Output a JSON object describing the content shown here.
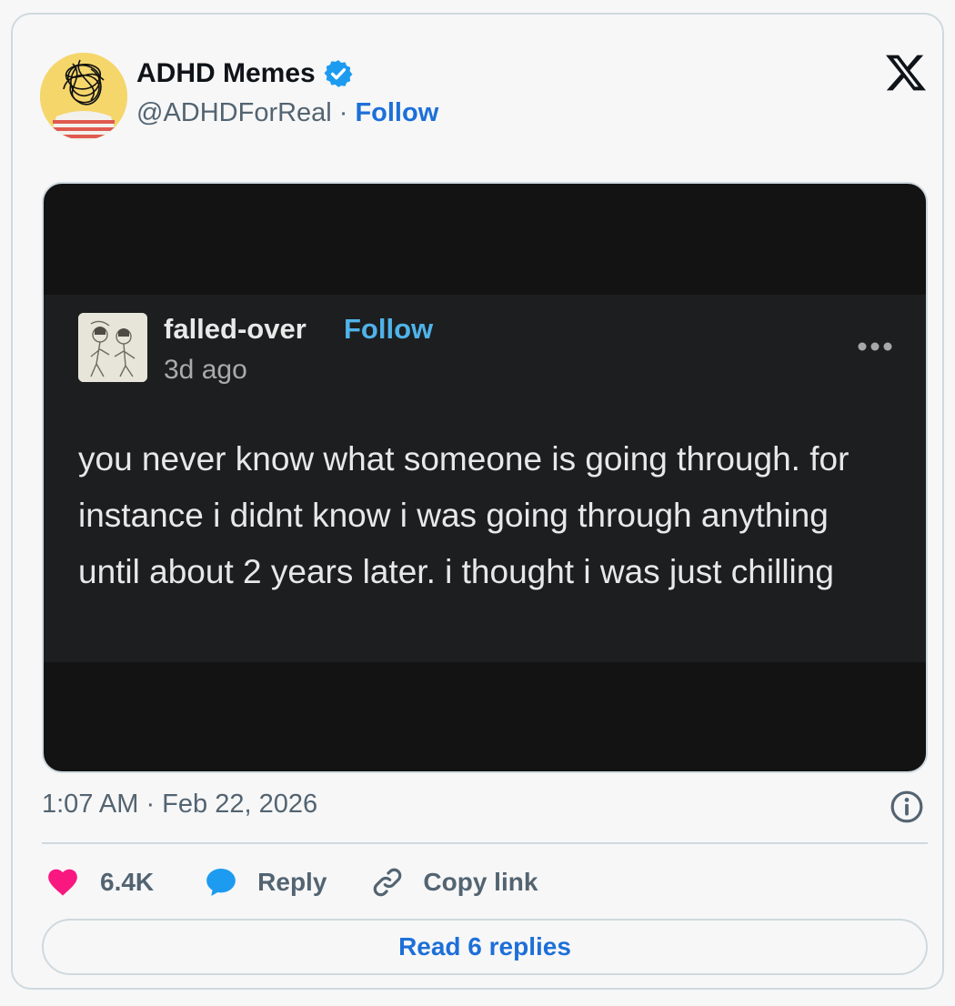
{
  "author": {
    "name": "ADHD Memes",
    "handle": "@ADHDForReal",
    "separator": "·",
    "follow_label": "Follow",
    "verified": true
  },
  "embedded_post": {
    "username": "falled-over",
    "follow_label": "Follow",
    "time_ago": "3d ago",
    "text": "you never know what someone is going through. for instance i didnt know i was going through anything until about 2 years later. i thought i was just chilling"
  },
  "meta": {
    "timestamp": "1:07 AM · Feb 22, 2026"
  },
  "actions": {
    "likes": "6.4K",
    "reply_label": "Reply",
    "copy_link_label": "Copy link"
  },
  "read_replies_label": "Read 6 replies",
  "colors": {
    "accent": "#1d6fd8",
    "like": "#f91880",
    "reply_bubble": "#1d9bf0",
    "verified": "#1d9bf0",
    "muted_text": "#536471"
  }
}
